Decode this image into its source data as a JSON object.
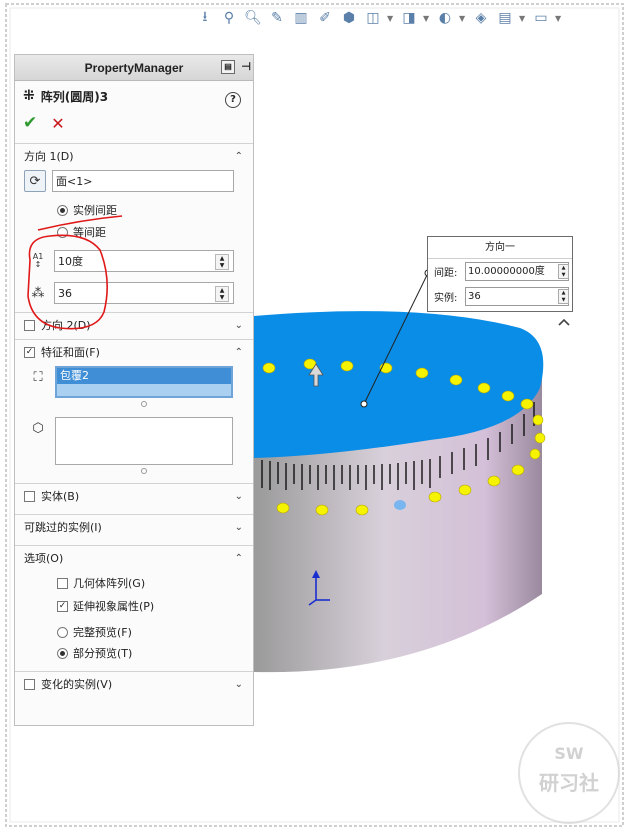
{
  "panel": {
    "header_title": "PropertyManager",
    "feature_title": "阵列(圆周)3",
    "help_glyph": "?",
    "ok_glyph": "✔",
    "cancel_glyph": "✕",
    "direction1": {
      "label": "方向 1(D)",
      "face_field": "面<1>",
      "radio_instance_spacing": "实例间距",
      "radio_equal_spacing": "等间距",
      "angle_value": "10度",
      "count_value": "36",
      "angle_icon_text": "A1"
    },
    "direction2": {
      "label": "方向 2(D)"
    },
    "features": {
      "label": "特征和面(F)",
      "selected_item": "包覆2"
    },
    "bodies": {
      "label": "实体(B)"
    },
    "skip": {
      "label": "可跳过的实例(I)"
    },
    "options": {
      "label": "选项(O)",
      "geometry_pattern": "几何体阵列(G)",
      "propagate_visual": "延伸视象属性(P)",
      "full_preview": "完整预览(F)",
      "partial_preview": "部分预览(T)"
    },
    "varied": {
      "label": "变化的实例(V)"
    }
  },
  "callout": {
    "title": "方向一",
    "spacing_label": "间距:",
    "spacing_value": "10.00000000度",
    "count_label": "实例:",
    "count_value": "36"
  },
  "watermark": {
    "top": "SW",
    "bottom": "研习社"
  },
  "colors": {
    "cylinder_top": "#0a8de6",
    "cylinder_side": "#c9b9cf",
    "marker_yellow": "#f6f300",
    "annotation_red": "#e01818",
    "selection_blue": "#3f8ed6"
  },
  "icons": [
    "select-icon",
    "zoom-fit-icon",
    "zoom-area-icon",
    "previous-view-icon",
    "section-view-icon",
    "dynamic-annotation-icon",
    "view-orientation-icon",
    "display-style-icon",
    "hide-show-icon",
    "scene-icon",
    "view-settings-icon",
    "monitor-icon"
  ]
}
